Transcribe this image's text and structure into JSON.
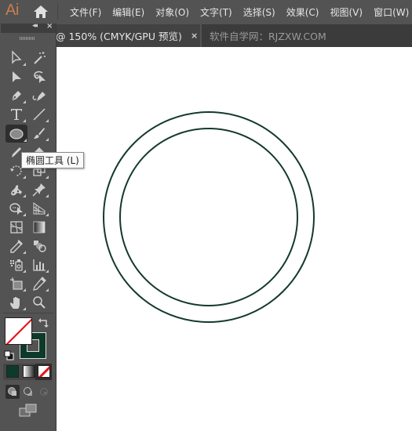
{
  "app": {
    "logo": "Ai",
    "home_icon": "home-icon"
  },
  "menu": {
    "items": [
      "文件(F)",
      "编辑(E)",
      "对象(O)",
      "文字(T)",
      "选择(S)",
      "效果(C)",
      "视图(V)",
      "窗口(W)"
    ]
  },
  "tabs": {
    "active": {
      "label": "@ 150% (CMYK/GPU 预览)",
      "close": "×"
    },
    "inactive": {
      "label": "软件自学网：RJZXW.COM"
    }
  },
  "toolbox": {
    "collapse": "◂◂",
    "close": "×",
    "tools": [
      {
        "name": "direct-selection-tool"
      },
      {
        "name": "magic-wand-tool"
      },
      {
        "name": "selection-tool"
      },
      {
        "name": "lasso-tool"
      },
      {
        "name": "pen-tool"
      },
      {
        "name": "curvature-tool"
      },
      {
        "name": "type-tool"
      },
      {
        "name": "line-segment-tool"
      },
      {
        "name": "ellipse-tool",
        "active": true
      },
      {
        "name": "paintbrush-tool"
      },
      {
        "name": "pencil-tool"
      },
      {
        "name": "eraser-tool"
      },
      {
        "name": "rotate-tool"
      },
      {
        "name": "free-transform-tool"
      },
      {
        "name": "puppet-warp-tool"
      },
      {
        "name": "pin-tool"
      },
      {
        "name": "shape-builder-tool"
      },
      {
        "name": "perspective-grid-tool"
      },
      {
        "name": "mesh-tool"
      },
      {
        "name": "gradient-tool"
      },
      {
        "name": "eyedropper-tool"
      },
      {
        "name": "blend-tool"
      },
      {
        "name": "symbol-sprayer-tool"
      },
      {
        "name": "column-graph-tool"
      },
      {
        "name": "artboard-tool"
      },
      {
        "name": "slice-tool"
      },
      {
        "name": "hand-tool"
      },
      {
        "name": "zoom-tool"
      }
    ],
    "tooltip": "椭圆工具 (L)",
    "fill_color": "none",
    "stroke_color": "#0e3a2a"
  },
  "canvas": {
    "stroke_color": "#143a2c",
    "shapes": [
      {
        "type": "circle",
        "name": "outer-circle"
      },
      {
        "type": "circle",
        "name": "inner-circle"
      }
    ]
  }
}
